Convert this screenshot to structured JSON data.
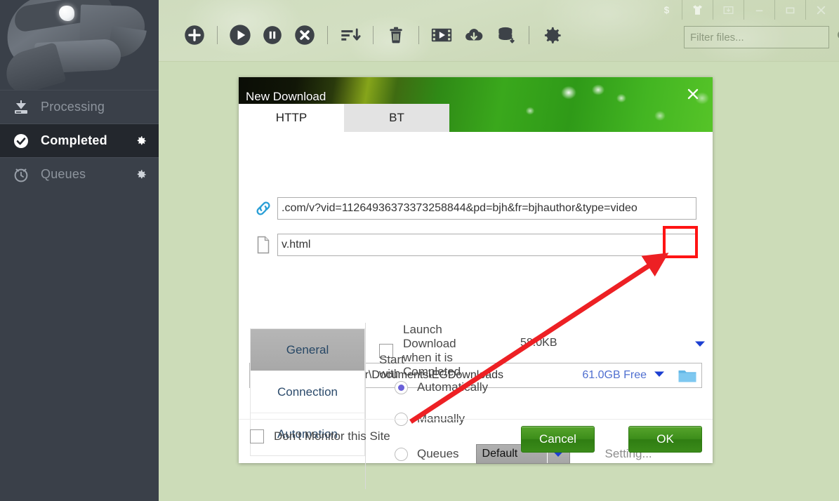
{
  "sidebar": {
    "logo_name": "eagle-logo",
    "items": [
      {
        "label": "Processing",
        "icon": "download-tray-icon",
        "active": false,
        "has_gear": false
      },
      {
        "label": "Completed",
        "icon": "check-circle-icon",
        "active": true,
        "has_gear": true
      },
      {
        "label": "Queues",
        "icon": "clock-icon",
        "active": false,
        "has_gear": true
      }
    ]
  },
  "toolbar": {
    "buttons": [
      {
        "name": "add-download-button",
        "icon": "plus-circle-icon"
      },
      {
        "name": "resume-button",
        "icon": "play-circle-icon"
      },
      {
        "name": "pause-button",
        "icon": "pause-circle-icon"
      },
      {
        "name": "stop-button",
        "icon": "stop-circle-icon"
      },
      {
        "name": "sort-button",
        "icon": "sort-descending-icon"
      },
      {
        "name": "delete-button",
        "icon": "trash-icon"
      },
      {
        "name": "video-converter-button",
        "icon": "film-play-icon"
      },
      {
        "name": "cloud-download-button",
        "icon": "cloud-download-icon"
      },
      {
        "name": "database-button",
        "icon": "database-download-icon"
      },
      {
        "name": "settings-button",
        "icon": "gear-icon"
      }
    ],
    "filter": {
      "placeholder": "Filter files...",
      "value": "",
      "search_icon": "magnifier-icon"
    }
  },
  "window_controls": [
    {
      "name": "donate-button",
      "icon": "dollar-icon"
    },
    {
      "name": "skins-button",
      "icon": "tshirt-icon"
    },
    {
      "name": "minimize-tray-button",
      "icon": "tray-down-icon"
    },
    {
      "name": "minimize-button",
      "icon": "minimize-icon"
    },
    {
      "name": "maximize-button",
      "icon": "maximize-icon"
    },
    {
      "name": "close-button",
      "icon": "close-x-icon"
    }
  ],
  "dialog": {
    "title": "New Download",
    "close_icon": "close-x-icon",
    "tabs": [
      {
        "label": "HTTP",
        "active": true
      },
      {
        "label": "BT",
        "active": false
      }
    ],
    "url_field": {
      "icon": "link-chain-icon",
      "value": ".com/v?vid=11264936373373258844&pd=bjh&fr=bjhauthor&type=video",
      "placeholder": ""
    },
    "file_field": {
      "icon": "file-page-icon",
      "value": "v.html",
      "placeholder": ""
    },
    "size_label": "58.0KB",
    "size_caret_icon": "caret-down-icon",
    "path": {
      "value": "C:\\Users\\Administrator\\Documents\\EGDownloads",
      "free_space": "61.0GB Free",
      "caret_icon": "caret-down-icon",
      "browse_icon": "folder-icon"
    },
    "side_tabs": [
      {
        "label": "General",
        "active": true
      },
      {
        "label": "Connection",
        "active": false
      },
      {
        "label": "Automation",
        "active": false
      }
    ],
    "options": {
      "launch_on_complete": {
        "label": "Launch Download when it is Completed",
        "checked": false
      },
      "start_with_label": "Start with",
      "radios": [
        {
          "label": "Automatically",
          "selected": true
        },
        {
          "label": "Manually",
          "selected": false
        },
        {
          "label": "Queues",
          "selected": false
        }
      ],
      "queue_select": {
        "value": "Default",
        "caret_icon": "caret-down-icon"
      },
      "setting_link": "Setting..."
    },
    "footer": {
      "dont_monitor": {
        "label": "Don't Monitor this Site",
        "checked": false
      },
      "cancel_label": "Cancel",
      "ok_label": "OK"
    }
  },
  "annotation": {
    "highlight_target": "folder-browse-button",
    "color": "#ff1414"
  },
  "colors": {
    "sidebar_bg": "#3a4049",
    "sidebar_active_bg": "#23272d",
    "app_bg": "#ccdcb8",
    "accent_green": "#3d8e1b",
    "link_blue": "#4f6fd0",
    "radio_purple": "#6a60d8",
    "annotation_red": "#ff1414"
  }
}
